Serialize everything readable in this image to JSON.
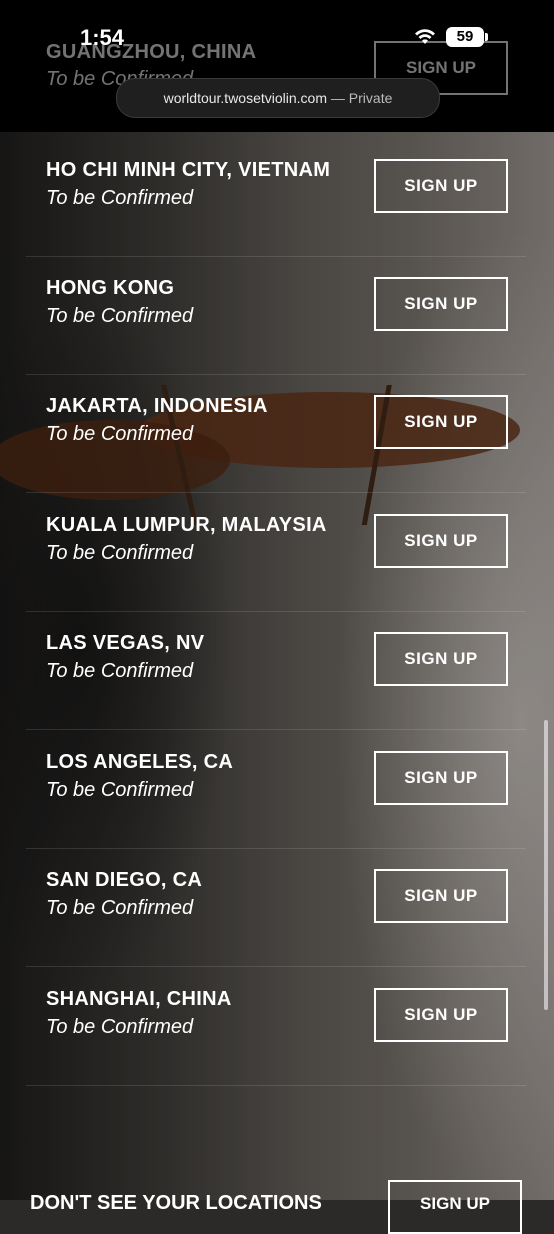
{
  "status_bar": {
    "time": "1:54",
    "battery": "59"
  },
  "browser": {
    "url": "worldtour.twosetviolin.com",
    "separator": "—",
    "mode": "Private"
  },
  "signup_label": "SIGN UP",
  "locations": [
    {
      "city": "GUANGZHOU, CHINA",
      "status": "To be Confirmed"
    },
    {
      "city": "HO CHI MINH CITY, VIETNAM",
      "status": "To be Confirmed"
    },
    {
      "city": "HONG KONG",
      "status": "To be Confirmed"
    },
    {
      "city": "JAKARTA, INDONESIA",
      "status": "To be Confirmed"
    },
    {
      "city": "KUALA LUMPUR, MALAYSIA",
      "status": "To be Confirmed"
    },
    {
      "city": "LAS VEGAS, NV",
      "status": "To be Confirmed"
    },
    {
      "city": "LOS ANGELES, CA",
      "status": "To be Confirmed"
    },
    {
      "city": "SAN DIEGO, CA",
      "status": "To be Confirmed"
    },
    {
      "city": "SHANGHAI, CHINA",
      "status": "To be Confirmed"
    }
  ],
  "footer": {
    "prompt": "DON'T SEE YOUR LOCATIONS",
    "button": "SIGN UP"
  }
}
